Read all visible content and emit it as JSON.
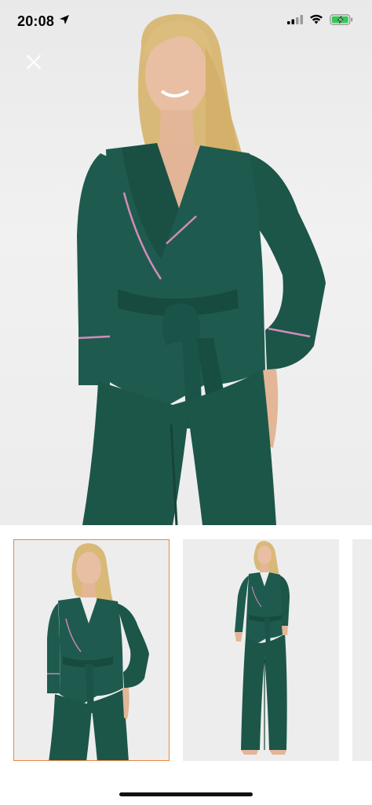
{
  "status_bar": {
    "time": "20:08",
    "location_icon": "location-arrow-icon",
    "signal_icon": "cellular-signal-icon",
    "wifi_icon": "wifi-icon",
    "battery_icon": "battery-charging-icon"
  },
  "viewer": {
    "close_icon": "close-icon",
    "thumbnail_count": 3,
    "selected_index": 0
  },
  "colors": {
    "garment": "#1e5b4e",
    "piping": "#d48bbb",
    "selected_border": "#e8893f",
    "battery_fill": "#35c759"
  }
}
